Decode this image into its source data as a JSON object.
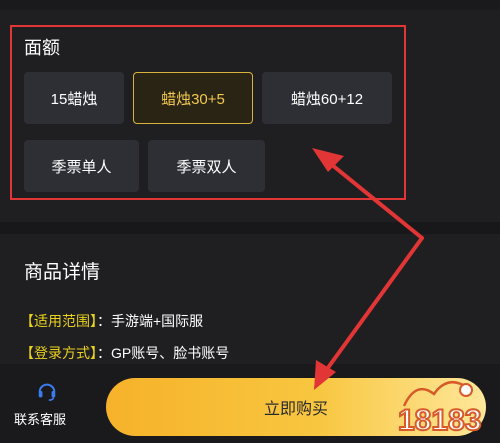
{
  "denomination": {
    "title": "面额",
    "options": [
      {
        "label": "15蜡烛",
        "selected": false
      },
      {
        "label": "蜡烛30+5",
        "selected": true
      },
      {
        "label": "蜡烛60+12",
        "selected": false
      },
      {
        "label": "季票单人",
        "selected": false
      },
      {
        "label": "季票双人",
        "selected": false
      }
    ]
  },
  "details": {
    "title": "商品详情",
    "rows": [
      {
        "label": "【适用范围】",
        "value": "：手游端+国际服"
      },
      {
        "label": "【登录方式】",
        "value": "：GP账号、脸书账号"
      }
    ]
  },
  "bottom": {
    "customer_service_label": "联系客服",
    "buy_label": "立即购买"
  },
  "watermark": {
    "text": "18183"
  },
  "colors": {
    "accent_gold": "#f3c94d",
    "highlight_red": "#e23535",
    "label_yellow": "#e9d21a",
    "cs_icon_blue": "#3a7bf0"
  },
  "icons": [
    "headset-icon",
    "annotation-arrow-icon"
  ]
}
